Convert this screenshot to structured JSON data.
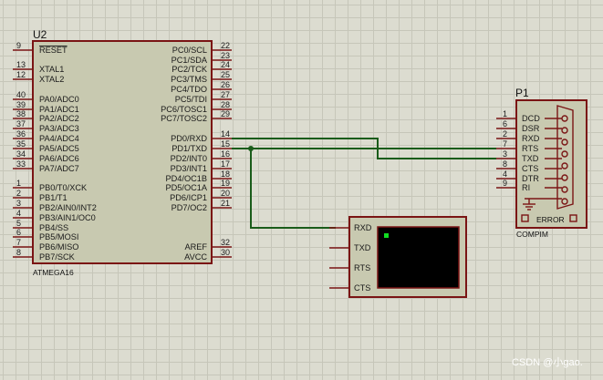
{
  "u2": {
    "ref": "U2",
    "part": "ATMEGA16",
    "left_pins": [
      {
        "num": "9",
        "name": "RESET",
        "overline": true
      },
      {
        "num": "13",
        "name": "XTAL1"
      },
      {
        "num": "12",
        "name": "XTAL2"
      },
      {
        "num": "40",
        "name": "PA0/ADC0"
      },
      {
        "num": "39",
        "name": "PA1/ADC1"
      },
      {
        "num": "38",
        "name": "PA2/ADC2"
      },
      {
        "num": "37",
        "name": "PA3/ADC3"
      },
      {
        "num": "36",
        "name": "PA4/ADC4"
      },
      {
        "num": "35",
        "name": "PA5/ADC5"
      },
      {
        "num": "34",
        "name": "PA6/ADC6"
      },
      {
        "num": "33",
        "name": "PA7/ADC7"
      },
      {
        "num": "1",
        "name": "PB0/T0/XCK"
      },
      {
        "num": "2",
        "name": "PB1/T1"
      },
      {
        "num": "3",
        "name": "PB2/AIN0/INT2"
      },
      {
        "num": "4",
        "name": "PB3/AIN1/OC0"
      },
      {
        "num": "5",
        "name": "PB4/SS"
      },
      {
        "num": "6",
        "name": "PB5/MOSI"
      },
      {
        "num": "7",
        "name": "PB6/MISO"
      },
      {
        "num": "8",
        "name": "PB7/SCK"
      }
    ],
    "right_pins": [
      {
        "num": "22",
        "name": "PC0/SCL"
      },
      {
        "num": "23",
        "name": "PC1/SDA"
      },
      {
        "num": "24",
        "name": "PC2/TCK"
      },
      {
        "num": "25",
        "name": "PC3/TMS"
      },
      {
        "num": "26",
        "name": "PC4/TDO"
      },
      {
        "num": "27",
        "name": "PC5/TDI"
      },
      {
        "num": "28",
        "name": "PC6/TOSC1"
      },
      {
        "num": "29",
        "name": "PC7/TOSC2"
      },
      {
        "num": "14",
        "name": "PD0/RXD"
      },
      {
        "num": "15",
        "name": "PD1/TXD"
      },
      {
        "num": "16",
        "name": "PD2/INT0"
      },
      {
        "num": "17",
        "name": "PD3/INT1"
      },
      {
        "num": "18",
        "name": "PD4/OC1B"
      },
      {
        "num": "19",
        "name": "PD5/OC1A"
      },
      {
        "num": "20",
        "name": "PD6/ICP1"
      },
      {
        "num": "21",
        "name": "PD7/OC2"
      },
      {
        "num": "32",
        "name": "AREF"
      },
      {
        "num": "30",
        "name": "AVCC"
      }
    ]
  },
  "p1": {
    "ref": "P1",
    "part": "COMPIM",
    "status": "ERROR",
    "pins": [
      {
        "num": "1",
        "name": "DCD"
      },
      {
        "num": "6",
        "name": "DSR"
      },
      {
        "num": "2",
        "name": "RXD"
      },
      {
        "num": "7",
        "name": "RTS"
      },
      {
        "num": "3",
        "name": "TXD"
      },
      {
        "num": "8",
        "name": "CTS"
      },
      {
        "num": "4",
        "name": "DTR"
      },
      {
        "num": "9",
        "name": "RI"
      }
    ]
  },
  "terminal": {
    "pins": [
      "RXD",
      "TXD",
      "RTS",
      "CTS"
    ]
  },
  "watermark": "CSDN @小gao."
}
